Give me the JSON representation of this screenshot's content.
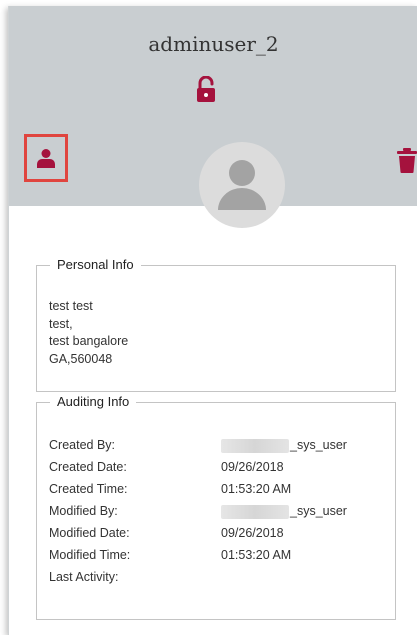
{
  "profile": {
    "username": "adminuser_2"
  },
  "colors": {
    "accent": "#a5123d",
    "header_bg": "#c9ced1",
    "highlight": "#e0453f"
  },
  "icons": {
    "lock": "lock-open-icon",
    "user": "user-icon",
    "trash": "trash-icon",
    "avatar": "avatar-icon"
  },
  "personal_info": {
    "title": "Personal Info",
    "lines": [
      "test test",
      "test,",
      "test bangalore",
      "GA,560048"
    ]
  },
  "auditing_info": {
    "title": "Auditing Info",
    "rows": [
      {
        "label": "Created By:",
        "value": "_sys_user"
      },
      {
        "label": "Created Date:",
        "value": "09/26/2018"
      },
      {
        "label": "Created Time:",
        "value": "01:53:20 AM"
      },
      {
        "label": "Modified By:",
        "value": "_sys_user"
      },
      {
        "label": "Modified Date:",
        "value": "09/26/2018"
      },
      {
        "label": "Modified Time:",
        "value": "01:53:20 AM"
      },
      {
        "label": "Last Activity:",
        "value": ""
      }
    ]
  }
}
